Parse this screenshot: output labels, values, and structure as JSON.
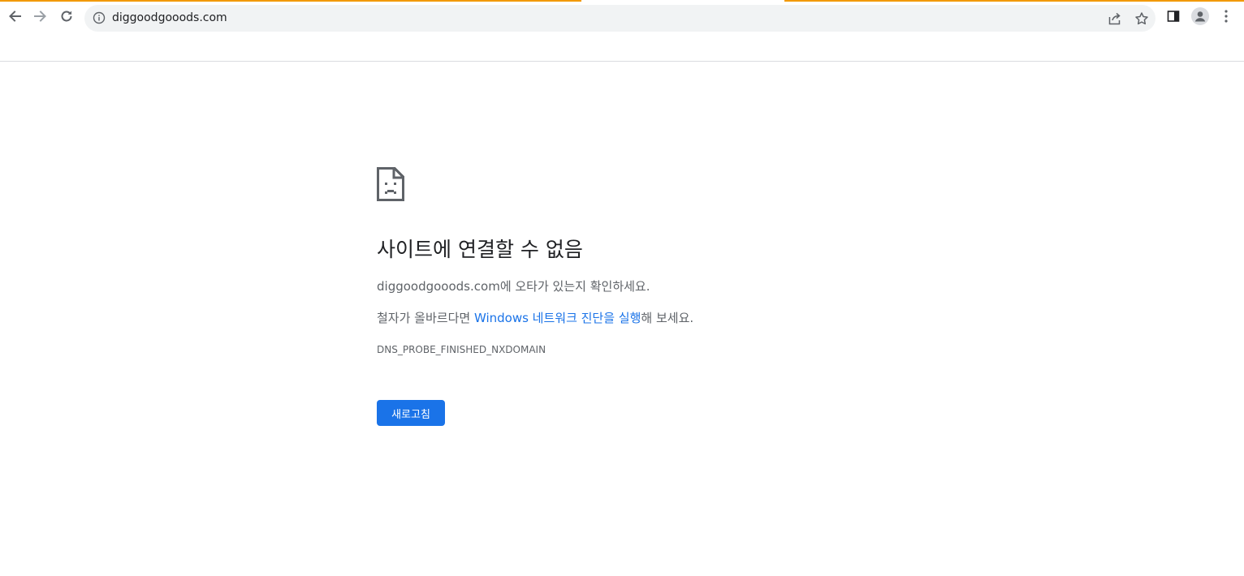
{
  "browser": {
    "url": "diggoodgooods.com",
    "colors": {
      "loading_bar": "#f29900",
      "omnibox_bg": "#f1f3f4",
      "link": "#1a73e8",
      "button": "#1a73e8"
    },
    "icons": {
      "back": "arrow-left-icon",
      "forward": "arrow-right-icon",
      "reload": "reload-icon",
      "site_info": "info-icon",
      "share": "share-icon",
      "bookmark": "star-icon",
      "side_panel": "side-panel-icon",
      "profile": "profile-icon",
      "menu": "kebab-menu-icon"
    }
  },
  "error_page": {
    "icon": "sad-document-icon",
    "title": "사이트에 연결할 수 없음",
    "line1_domain": "diggoodgooods.com",
    "line1_suffix": "에 오타가 있는지 확인하세요.",
    "line2_prefix": "철자가 올바르다면 ",
    "line2_link": "Windows 네트워크 진단을 실행",
    "line2_suffix": "해 보세요.",
    "error_code": "DNS_PROBE_FINISHED_NXDOMAIN",
    "reload_button": "새로고침"
  }
}
